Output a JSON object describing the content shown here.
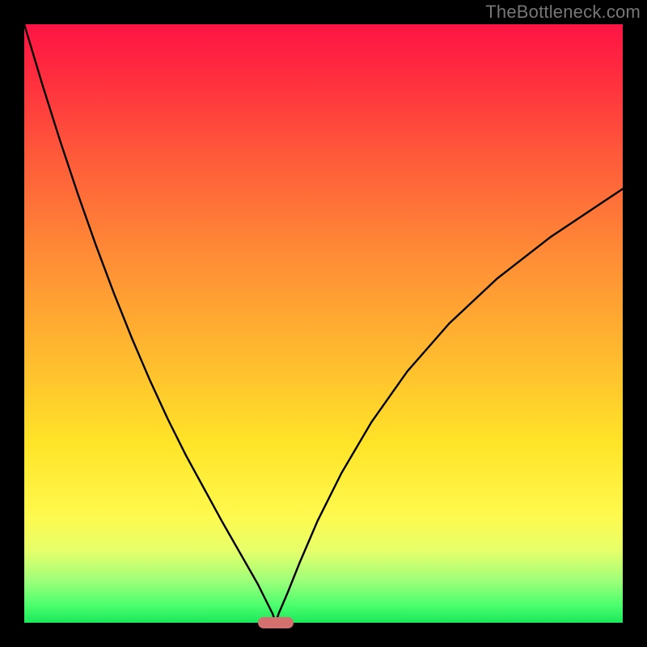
{
  "watermark": "TheBottleneck.com",
  "chart_data": {
    "type": "line",
    "title": "",
    "xlabel": "",
    "ylabel": "",
    "xlim": [
      0,
      100
    ],
    "ylim": [
      0,
      100
    ],
    "grid": false,
    "background_gradient": {
      "direction": "vertical",
      "stops": [
        {
          "pos": 0.0,
          "color": "#ff1445"
        },
        {
          "pos": 0.22,
          "color": "#ff5a3a"
        },
        {
          "pos": 0.55,
          "color": "#ffb92f"
        },
        {
          "pos": 0.82,
          "color": "#fff94d"
        },
        {
          "pos": 0.93,
          "color": "#9dff7a"
        },
        {
          "pos": 1.0,
          "color": "#19e85a"
        }
      ]
    },
    "series": [
      {
        "name": "bottleneck-curve",
        "color": "#000000",
        "x": [
          0.0,
          3.0,
          6.0,
          9.0,
          12.0,
          15.0,
          18.0,
          21.0,
          24.0,
          27.0,
          30.0,
          33.0,
          35.0,
          37.0,
          39.0,
          40.5,
          41.5,
          42.0,
          42.5,
          44.0,
          46.0,
          49.0,
          53.0,
          58.0,
          64.0,
          71.0,
          79.0,
          88.0,
          100.0
        ],
        "y": [
          100.0,
          90.0,
          80.5,
          71.5,
          63.0,
          55.0,
          47.5,
          40.5,
          34.0,
          28.0,
          22.5,
          17.0,
          13.5,
          10.0,
          6.5,
          3.5,
          1.5,
          0.0,
          1.5,
          5.0,
          10.0,
          17.0,
          25.0,
          33.5,
          42.0,
          50.0,
          57.5,
          64.5,
          72.5
        ]
      }
    ],
    "marker": {
      "name": "optimal-point",
      "x": 42.0,
      "y": 0.0,
      "color": "#d4706d",
      "shape": "pill"
    }
  }
}
